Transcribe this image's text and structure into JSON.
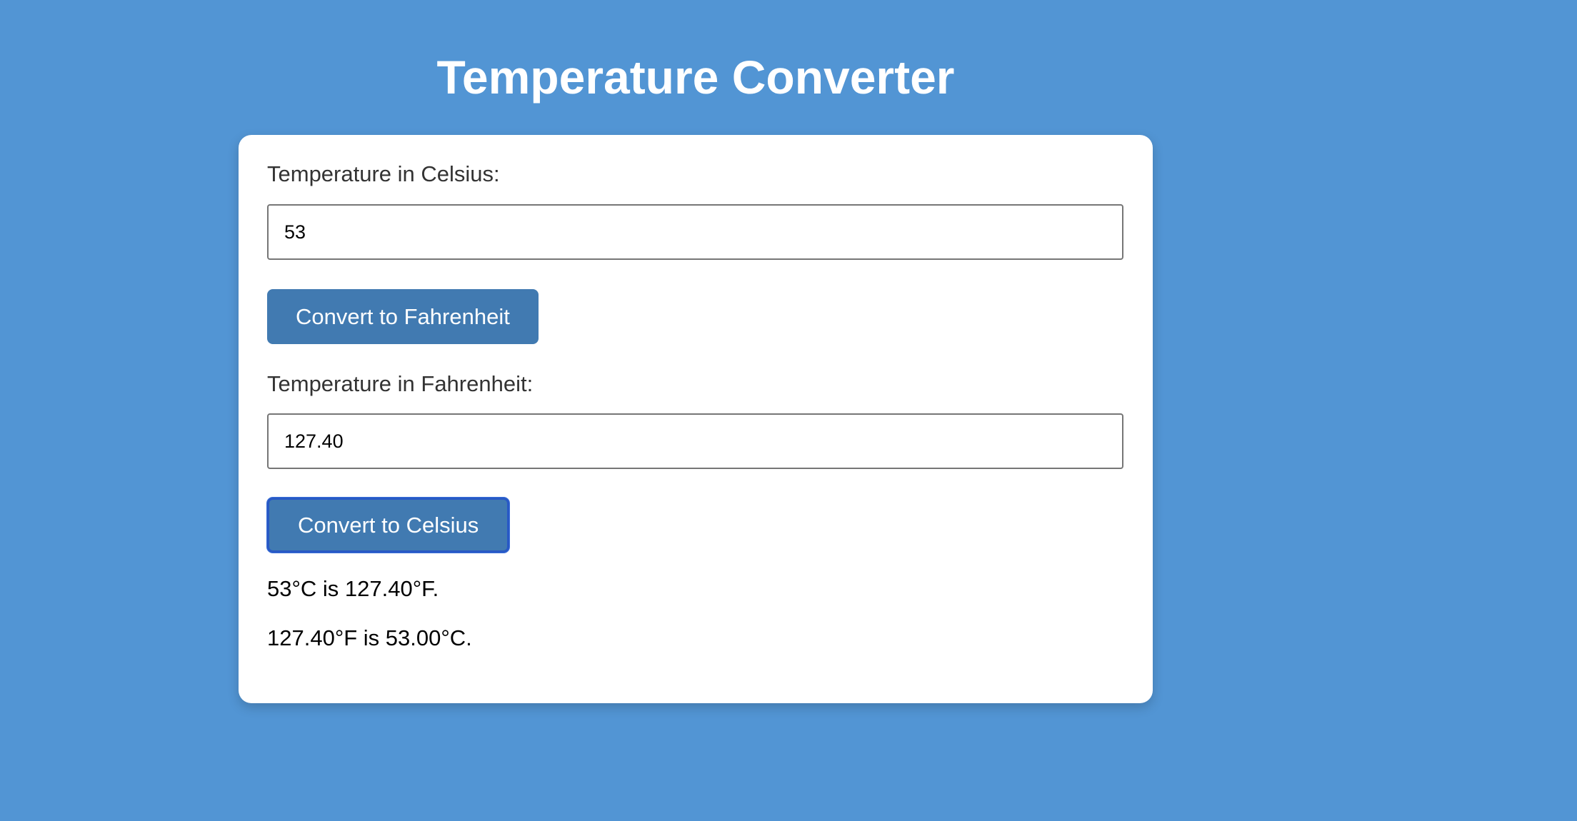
{
  "page": {
    "title": "Temperature Converter",
    "background_color": "#5295d4",
    "card_color": "#ffffff",
    "button_color": "#417ab1"
  },
  "celsius": {
    "label": "Temperature in Celsius:",
    "value": "53"
  },
  "to_fahrenheit_button": {
    "label": "Convert to Fahrenheit"
  },
  "fahrenheit": {
    "label": "Temperature in Fahrenheit:",
    "value": "127.40"
  },
  "to_celsius_button": {
    "label": "Convert to Celsius",
    "focused": true
  },
  "results": [
    "53°C is 127.40°F.",
    "127.40°F is 53.00°C."
  ]
}
